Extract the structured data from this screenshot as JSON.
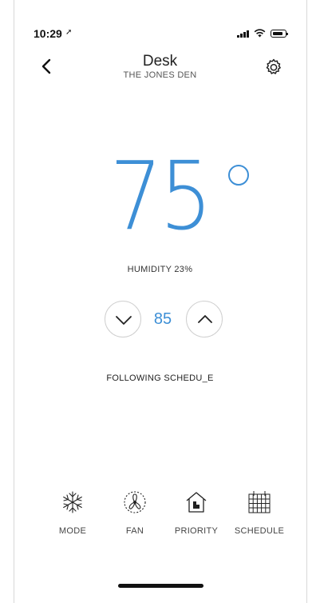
{
  "status_bar": {
    "time": "10:29"
  },
  "header": {
    "title": "Desk",
    "subtitle": "THE JONES DEN"
  },
  "thermostat": {
    "current_temperature": "75",
    "humidity": "HUMIDITY 23%",
    "setpoint": "85",
    "schedule_status": "FOLLOWING SCHEDU_E"
  },
  "nav": [
    {
      "label": "MODE",
      "icon": "snowflake-icon"
    },
    {
      "label": "FAN",
      "icon": "fan-icon"
    },
    {
      "label": "PRIORITY",
      "icon": "priority-house-icon"
    },
    {
      "label": "SCHEDULE",
      "icon": "calendar-grid-icon"
    }
  ],
  "colors": {
    "accent": "#3d8fd6"
  }
}
